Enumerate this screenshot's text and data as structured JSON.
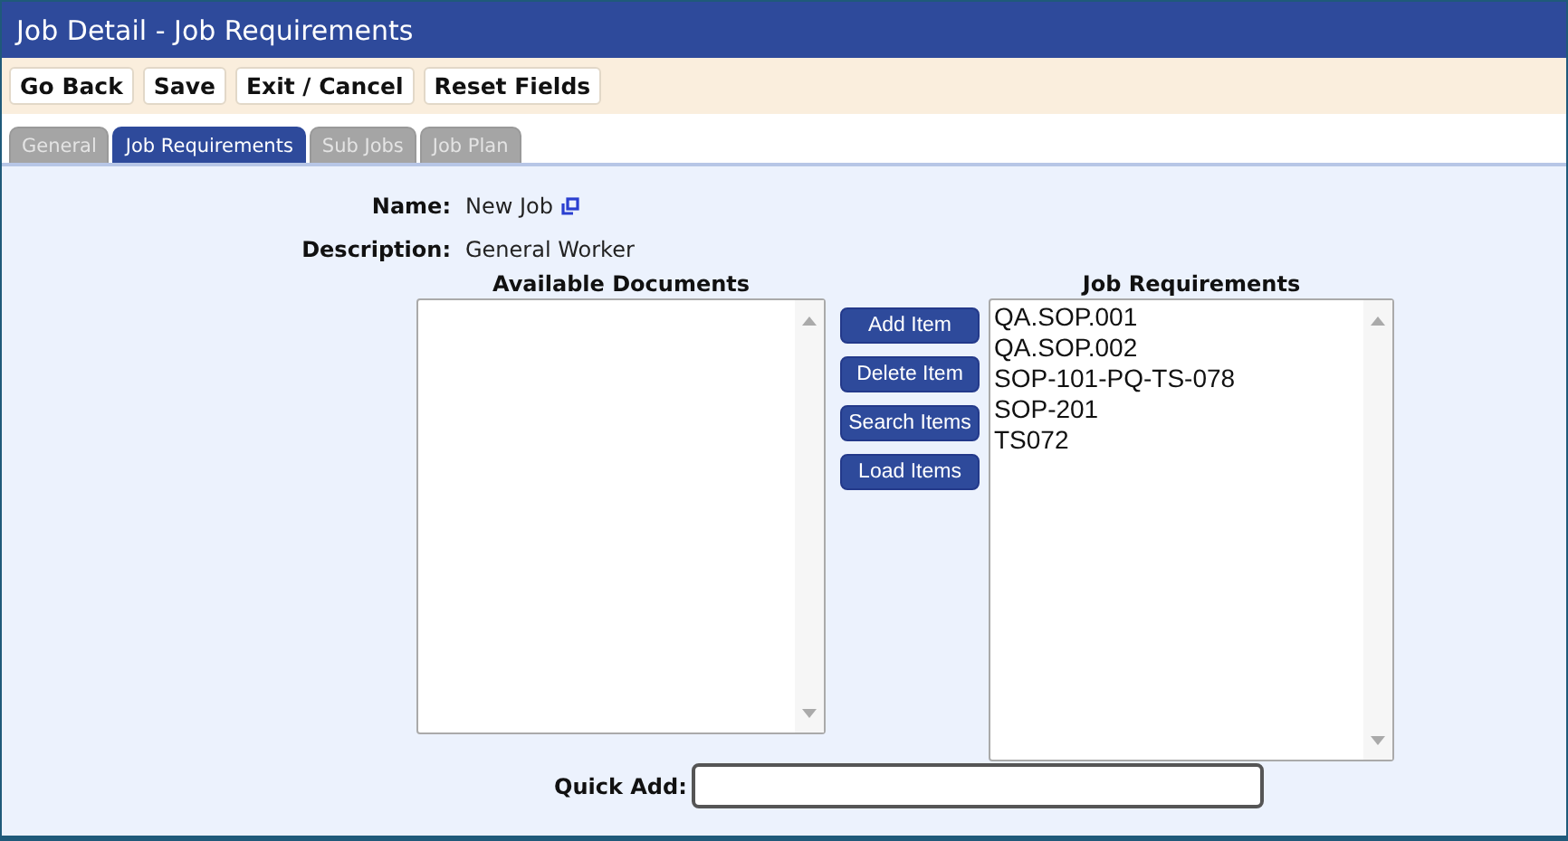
{
  "window": {
    "title": "Job Detail - Job Requirements"
  },
  "toolbar": [
    "Go Back",
    "Save",
    "Exit / Cancel",
    "Reset Fields"
  ],
  "tabs": [
    {
      "label": "General",
      "selected": false
    },
    {
      "label": "Job Requirements",
      "selected": true
    },
    {
      "label": "Sub Jobs",
      "selected": false
    },
    {
      "label": "Job Plan",
      "selected": false
    }
  ],
  "fields": [
    {
      "label": "Name:",
      "value": "New Job",
      "kind": "copyable"
    },
    {
      "label": "Description:",
      "value": "General Worker",
      "kind": "text"
    }
  ],
  "available_documents": {
    "heading": "Available Documents"
  },
  "actions": [
    "Add Item",
    "Delete Item",
    "Search Items",
    "Load Items"
  ],
  "job_requirements": {
    "heading": "Job Requirements",
    "items": [
      "QA.SOP.001",
      "QA.SOP.002",
      "SOP-101-PQ-TS-078",
      "SOP-201",
      "TS072"
    ]
  },
  "quick_add": {
    "label": "Quick Add:"
  }
}
